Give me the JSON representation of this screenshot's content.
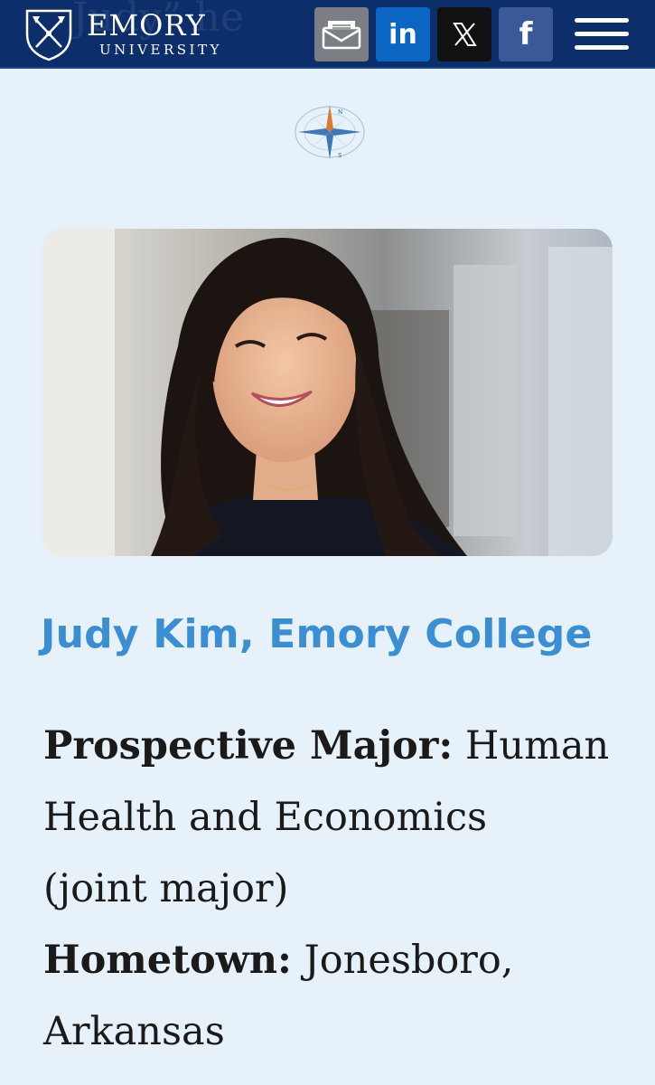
{
  "header": {
    "ghost_title": "Judy” he",
    "logo_name": "EMORY",
    "logo_sub": "UNIVERSITY",
    "share_buttons": [
      {
        "name": "email",
        "icon": "envelope-icon",
        "color": "#7b7f85"
      },
      {
        "name": "linkedin",
        "label": "in",
        "icon": "linkedin-icon",
        "color": "#0a66c2"
      },
      {
        "name": "x",
        "icon": "x-icon",
        "color": "#111111"
      },
      {
        "name": "facebook",
        "label": "f",
        "icon": "facebook-icon",
        "color": "#3b5998"
      }
    ],
    "menu_icon": "hamburger-menu-icon",
    "background": "#0c2f6b"
  },
  "compass": {
    "icon": "compass-rose-icon",
    "letters": [
      "N",
      "S"
    ]
  },
  "profile": {
    "photo_alt": "Portrait photo",
    "name_heading": "Judy Kim, Emory College",
    "heading_color": "#3a8fd4",
    "major_label": "Prospective Major:",
    "major_value_line1": "Human",
    "major_value_line2": "Health and Economics",
    "major_value_line3": "(joint major)",
    "hometown_label": "Hometown:",
    "hometown_value_line1": "Jonesboro,",
    "hometown_value_line2": "Arkansas",
    "partial_line": "Arkansas"
  },
  "page_background": "#e7f1f9"
}
